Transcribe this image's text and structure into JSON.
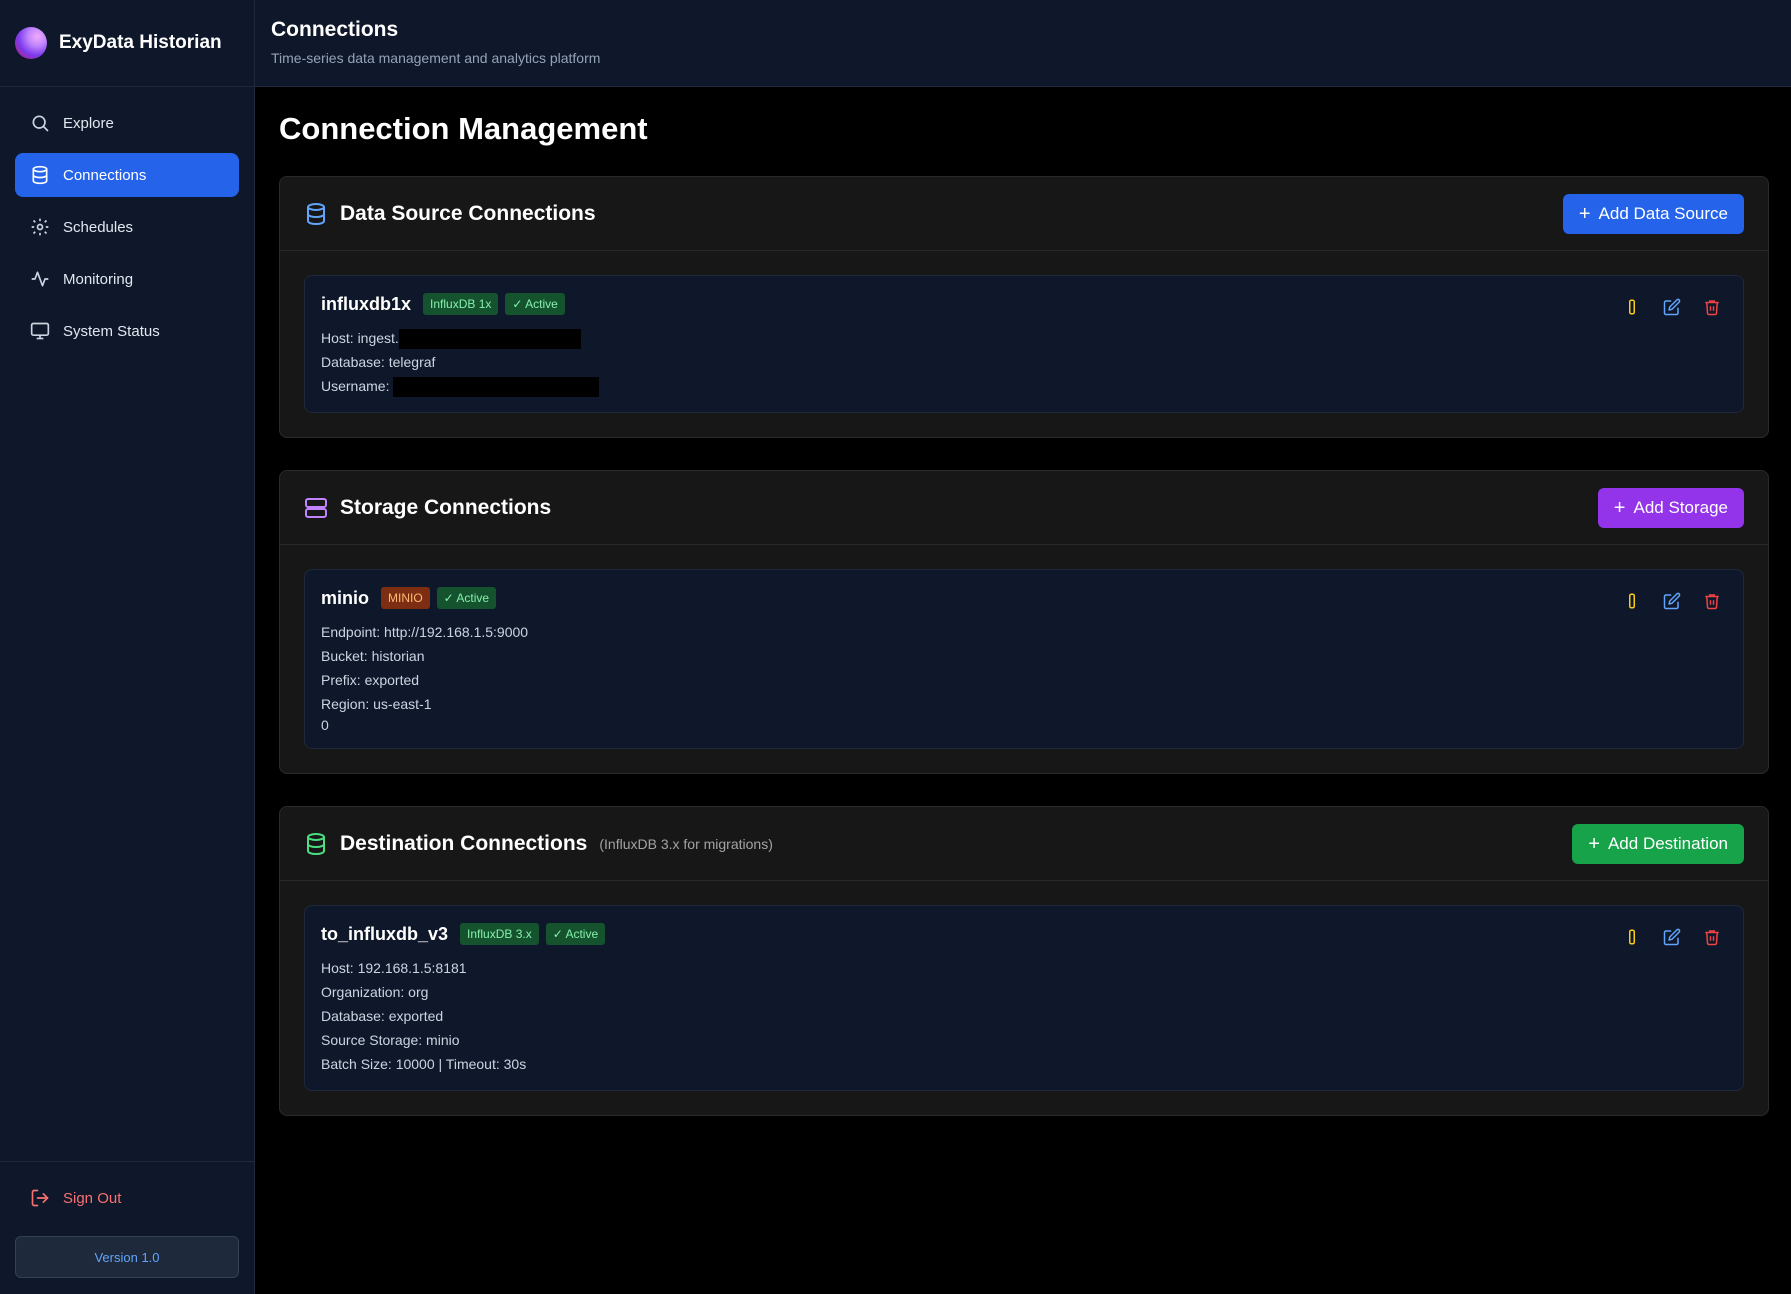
{
  "app": {
    "name": "ExyData Historian"
  },
  "sidebar": {
    "items": [
      {
        "label": "Explore",
        "icon": "search-icon"
      },
      {
        "label": "Connections",
        "icon": "database-icon",
        "active": true
      },
      {
        "label": "Schedules",
        "icon": "gear-icon"
      },
      {
        "label": "Monitoring",
        "icon": "activity-icon"
      },
      {
        "label": "System Status",
        "icon": "monitor-icon"
      }
    ],
    "sign_out": "Sign Out",
    "version": "Version 1.0"
  },
  "header": {
    "title": "Connections",
    "subtitle": "Time-series data management and analytics platform"
  },
  "page": {
    "title": "Connection Management"
  },
  "sections": {
    "data_source": {
      "title": "Data Source Connections",
      "button": "Add Data Source",
      "accent": "#2563eb",
      "card": {
        "name": "influxdb1x",
        "type_badge": "InfluxDB 1x",
        "status": "Active",
        "lines": [
          "Host: ingest.",
          "Database: telegraf",
          "Username: "
        ]
      }
    },
    "storage": {
      "title": "Storage Connections",
      "button": "Add Storage",
      "accent": "#9333ea",
      "card": {
        "name": "minio",
        "type_badge": "MINIO",
        "status": "Active",
        "lines": [
          "Endpoint: http://192.168.1.5:9000",
          "Bucket: historian",
          "Prefix: exported",
          "Region: us-east-1",
          "0"
        ]
      }
    },
    "destination": {
      "title": "Destination Connections",
      "note": "(InfluxDB 3.x for migrations)",
      "button": "Add Destination",
      "accent": "#16a34a",
      "card": {
        "name": "to_influxdb_v3",
        "type_badge": "InfluxDB 3.x",
        "status": "Active",
        "lines": [
          "Host: 192.168.1.5:8181",
          "Organization: org",
          "Database: exported",
          "Source Storage: minio",
          "Batch Size: 10000 | Timeout: 30s"
        ]
      }
    }
  }
}
